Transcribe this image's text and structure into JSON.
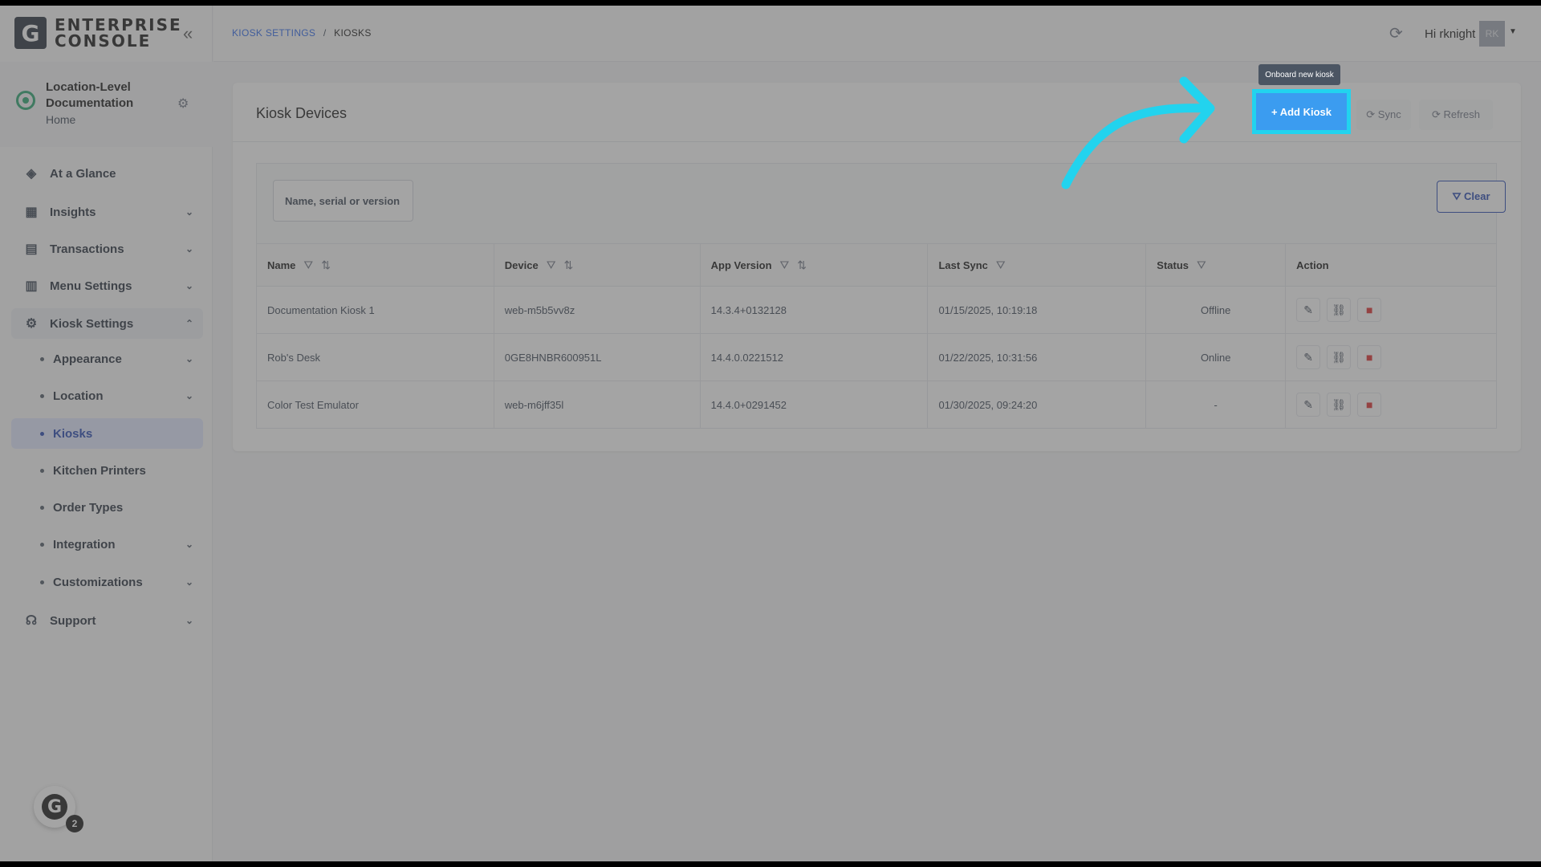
{
  "brand": {
    "logo_letter": "G",
    "line1": "ENTERPRISE",
    "line2": "CONSOLE",
    "collapse_icon": "double-chevron-left-icon"
  },
  "location": {
    "name": "Location-Level Documentation",
    "sub": "Home"
  },
  "sidebar": {
    "items": [
      {
        "label": "At a Glance",
        "icon": "layers-icon",
        "has_chevron": false
      },
      {
        "label": "Insights",
        "icon": "chart-icon",
        "has_chevron": true
      },
      {
        "label": "Transactions",
        "icon": "receipt-icon",
        "has_chevron": true
      },
      {
        "label": "Menu Settings",
        "icon": "menu-icon",
        "has_chevron": true
      },
      {
        "label": "Kiosk Settings",
        "icon": "gear-icon",
        "expanded": true
      }
    ],
    "sub_items": [
      {
        "label": "Appearance",
        "has_chevron": true
      },
      {
        "label": "Location",
        "has_chevron": true
      },
      {
        "label": "Kiosks",
        "active": true
      },
      {
        "label": "Kitchen Printers"
      },
      {
        "label": "Order Types"
      },
      {
        "label": "Integration",
        "has_chevron": true
      },
      {
        "label": "Customizations",
        "has_chevron": true
      }
    ],
    "support": "Support"
  },
  "help": {
    "letter": "G",
    "badge": "2"
  },
  "header": {
    "breadcrumb_link": "KIOSK SETTINGS",
    "breadcrumb_sep": "/",
    "breadcrumb_current": "KIOSKS",
    "greeting": "Hi rknight",
    "avatar": "RK"
  },
  "card": {
    "title": "Kiosk Devices",
    "add_label": "+ Add Kiosk",
    "tooltip": "Onboard new kiosk",
    "sync_label": "⟳ Sync",
    "refresh_label": "⟳ Refresh",
    "search_placeholder": "Name, serial or version",
    "clear_label": "⛛ Clear"
  },
  "table": {
    "headers": [
      "Name",
      "Device",
      "App Version",
      "Last Sync",
      "Status",
      "Action"
    ],
    "rows": [
      {
        "name": "Documentation Kiosk 1",
        "device": "web-m5b5vv8z",
        "version": "14.3.4+0132128",
        "last_sync": "01/15/2025, 10:19:18",
        "status": "Offline"
      },
      {
        "name": "Rob's Desk",
        "device": "0GE8HNBR600951L",
        "version": "14.4.0.0221512",
        "last_sync": "01/22/2025, 10:31:56",
        "status": "Online"
      },
      {
        "name": "Color Test Emulator",
        "device": "web-m6jff35l",
        "version": "14.4.0+0291452",
        "last_sync": "01/30/2025, 09:24:20",
        "status": "-"
      }
    ]
  },
  "colors": {
    "accent": "#3b9cf0",
    "highlight": "#22d3ee",
    "link": "#2563eb"
  }
}
